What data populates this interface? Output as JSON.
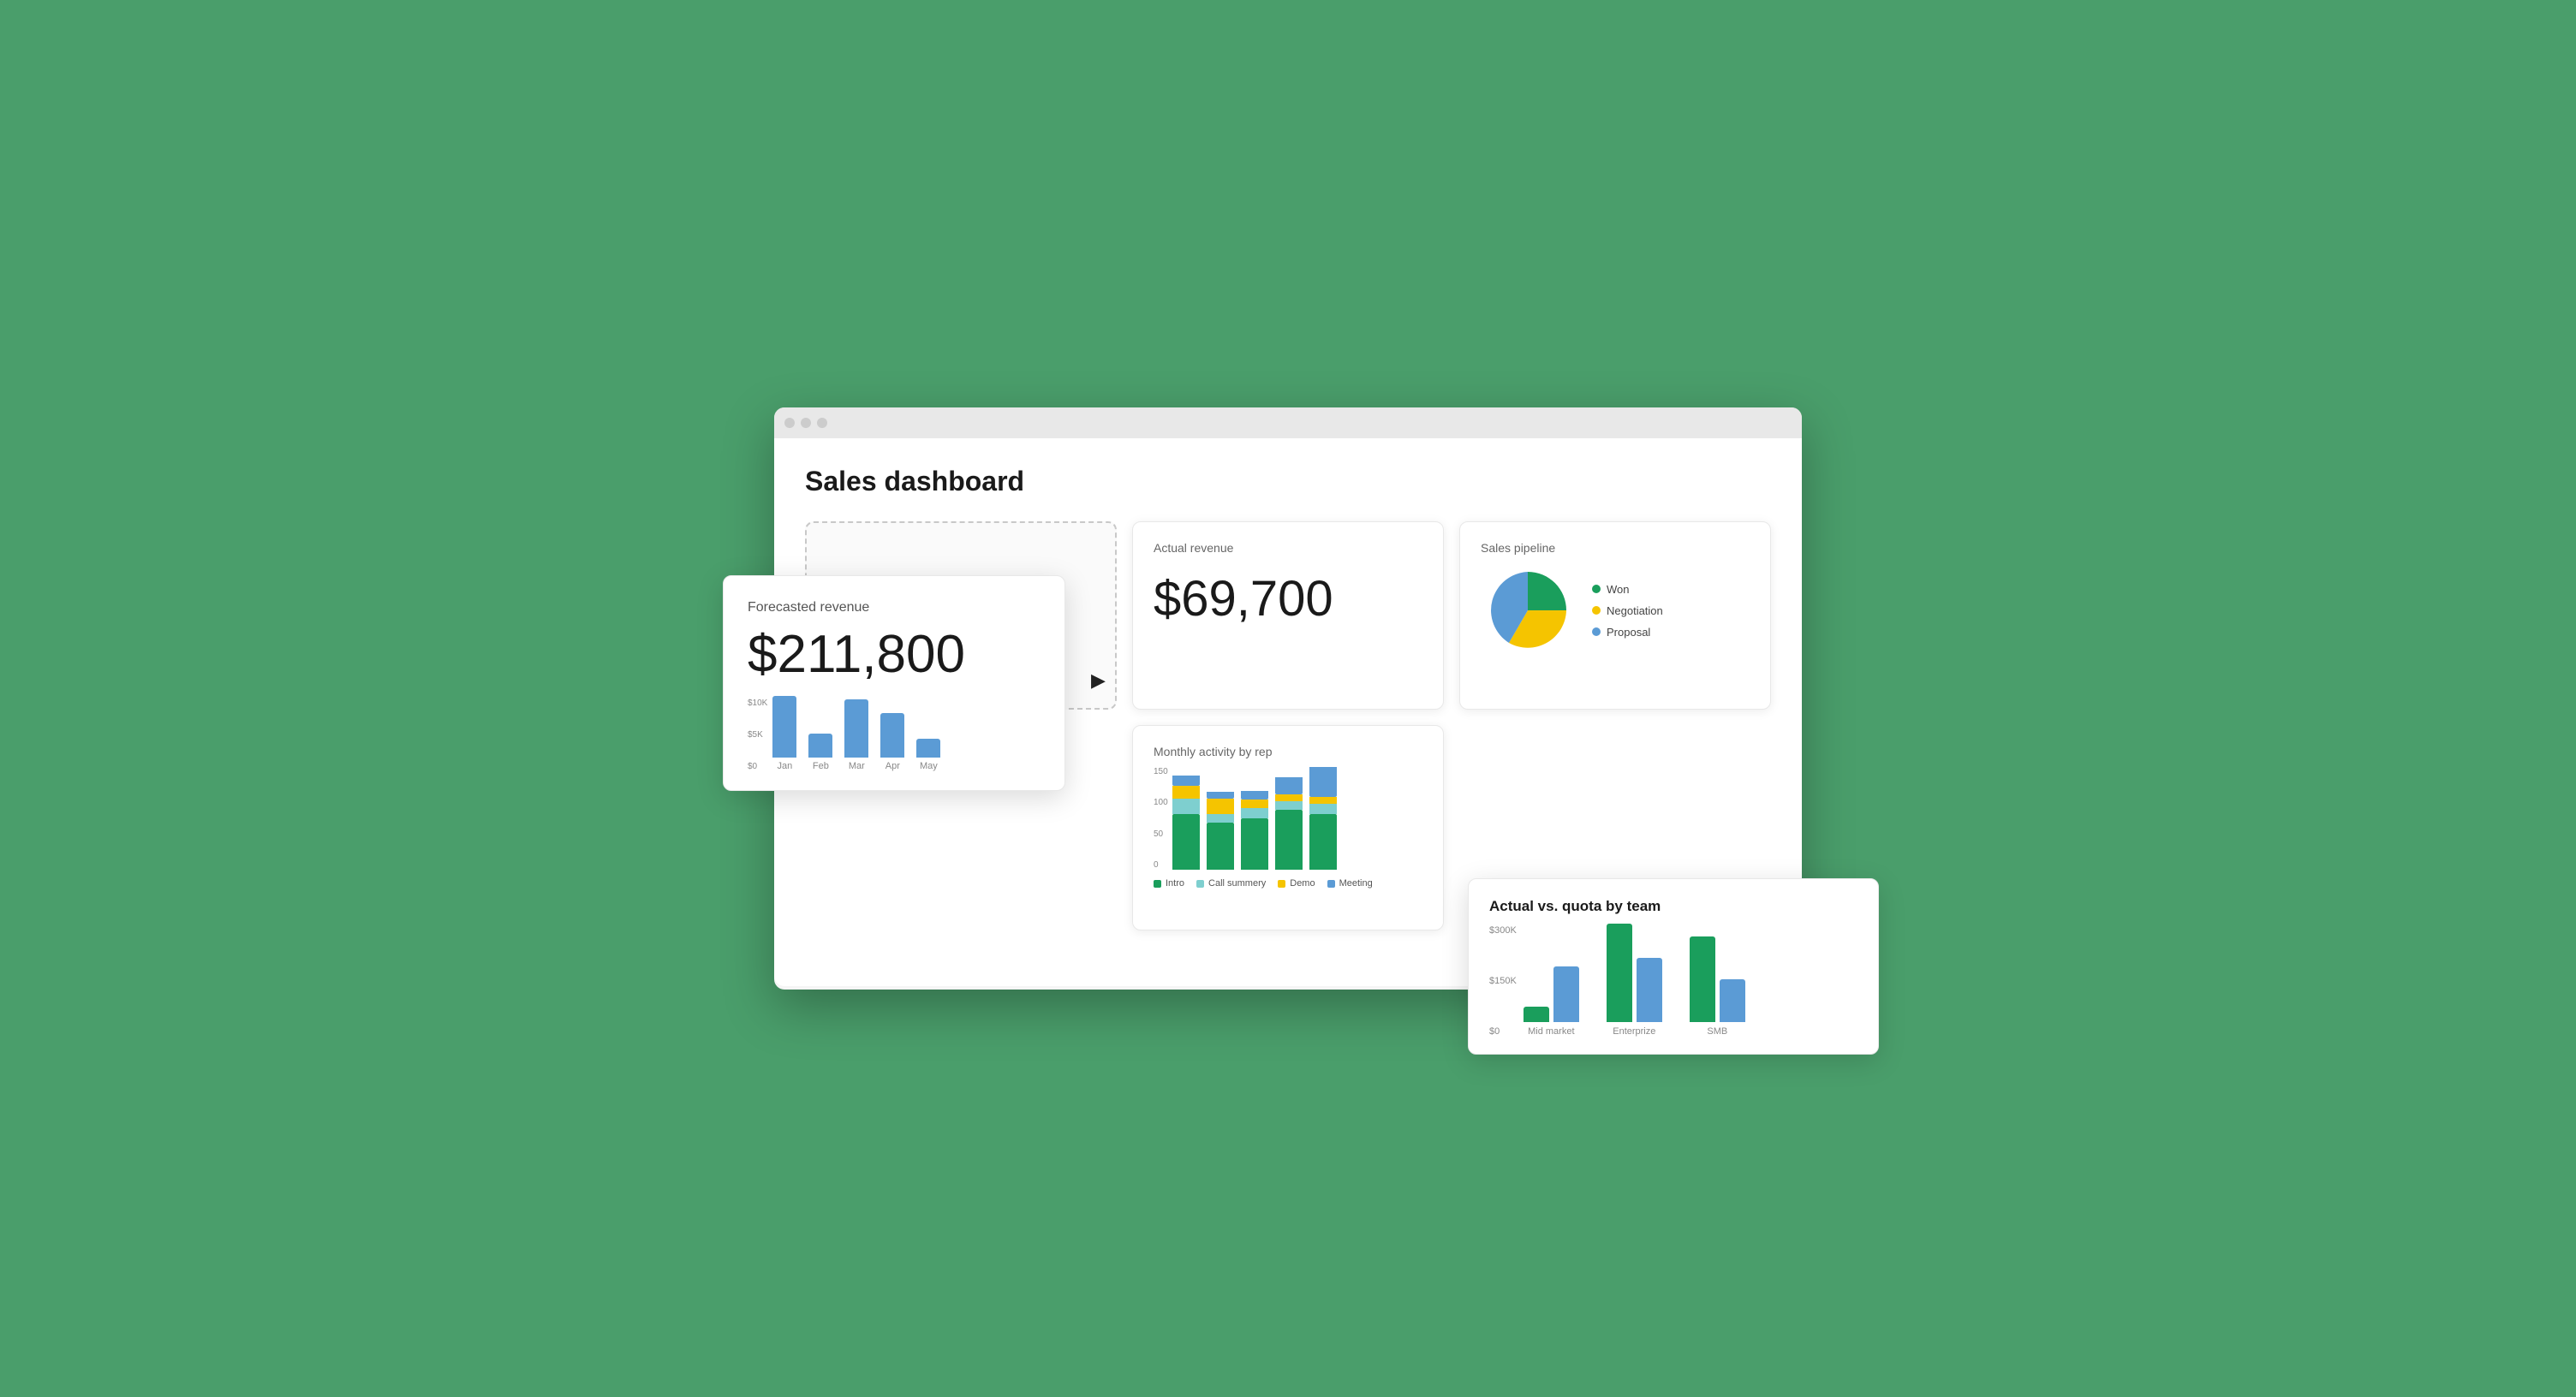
{
  "browser": {
    "dots": [
      "dot1",
      "dot2",
      "dot3"
    ]
  },
  "dashboard": {
    "title": "Sales dashboard",
    "cards": {
      "forecasted": {
        "label": "Forecasted revenue",
        "value": "$211,800"
      },
      "actual": {
        "label": "Actual revenue",
        "value": "$69,700"
      },
      "pipeline": {
        "label": "Sales pipeline",
        "legend": [
          {
            "color": "#1a9e5c",
            "name": "Won"
          },
          {
            "color": "#f5c400",
            "name": "Negotiation"
          },
          {
            "color": "#5b9bd5",
            "name": "Proposal"
          }
        ]
      },
      "monthly_activity": {
        "label": "Monthly activity by rep",
        "y_labels": [
          "150",
          "100",
          "50",
          "0"
        ],
        "reps": [
          {
            "bars": [
              {
                "color": "#1a9e5c",
                "h": 65
              },
              {
                "color": "#7ecfcf",
                "h": 18
              },
              {
                "color": "#f5c400",
                "h": 15
              },
              {
                "color": "#5b9bd5",
                "h": 12
              }
            ]
          },
          {
            "bars": [
              {
                "color": "#1a9e5c",
                "h": 55
              },
              {
                "color": "#7ecfcf",
                "h": 10
              },
              {
                "color": "#f5c400",
                "h": 18
              },
              {
                "color": "#5b9bd5",
                "h": 8
              }
            ]
          },
          {
            "bars": [
              {
                "color": "#1a9e5c",
                "h": 60
              },
              {
                "color": "#7ecfcf",
                "h": 12
              },
              {
                "color": "#f5c400",
                "h": 10
              },
              {
                "color": "#5b9bd5",
                "h": 10
              }
            ]
          },
          {
            "bars": [
              {
                "color": "#1a9e5c",
                "h": 70
              },
              {
                "color": "#7ecfcf",
                "h": 10
              },
              {
                "color": "#f5c400",
                "h": 8
              },
              {
                "color": "#5b9bd5",
                "h": 20
              }
            ]
          },
          {
            "bars": [
              {
                "color": "#1a9e5c",
                "h": 65
              },
              {
                "color": "#7ecfcf",
                "h": 12
              },
              {
                "color": "#f5c400",
                "h": 8
              },
              {
                "color": "#5b9bd5",
                "h": 35
              }
            ]
          }
        ],
        "legend": [
          {
            "color": "#1a9e5c",
            "name": "Intro"
          },
          {
            "color": "#7ecfcf",
            "name": "Call summery"
          },
          {
            "color": "#f5c400",
            "name": "Demo"
          },
          {
            "color": "#5b9bd5",
            "name": "Meeting"
          }
        ]
      },
      "forecast_mini_chart": {
        "y_labels": [
          "$10K",
          "$5K",
          "$0"
        ],
        "bars": [
          {
            "month": "Jan",
            "color": "#5b9bd5",
            "h": 72
          },
          {
            "month": "Feb",
            "color": "#5b9bd5",
            "h": 28
          },
          {
            "month": "Mar",
            "color": "#5b9bd5",
            "h": 68
          },
          {
            "month": "Apr",
            "color": "#5b9bd5",
            "h": 55
          },
          {
            "month": "May",
            "color": "#5b9bd5",
            "h": 22
          }
        ]
      },
      "quota": {
        "label": "Actual vs. quota by team",
        "y_labels": [
          "$300K",
          "$150K",
          "$0"
        ],
        "groups": [
          {
            "name": "Mid market",
            "actual_color": "#1a9e5c",
            "quota_color": "#5b9bd5",
            "actual_h": 18,
            "quota_h": 65
          },
          {
            "name": "Enterprize",
            "actual_color": "#1a9e5c",
            "quota_color": "#5b9bd5",
            "actual_h": 115,
            "quota_h": 75
          },
          {
            "name": "SMB",
            "actual_color": "#1a9e5c",
            "quota_color": "#5b9bd5",
            "actual_h": 100,
            "quota_h": 50
          }
        ]
      }
    }
  }
}
